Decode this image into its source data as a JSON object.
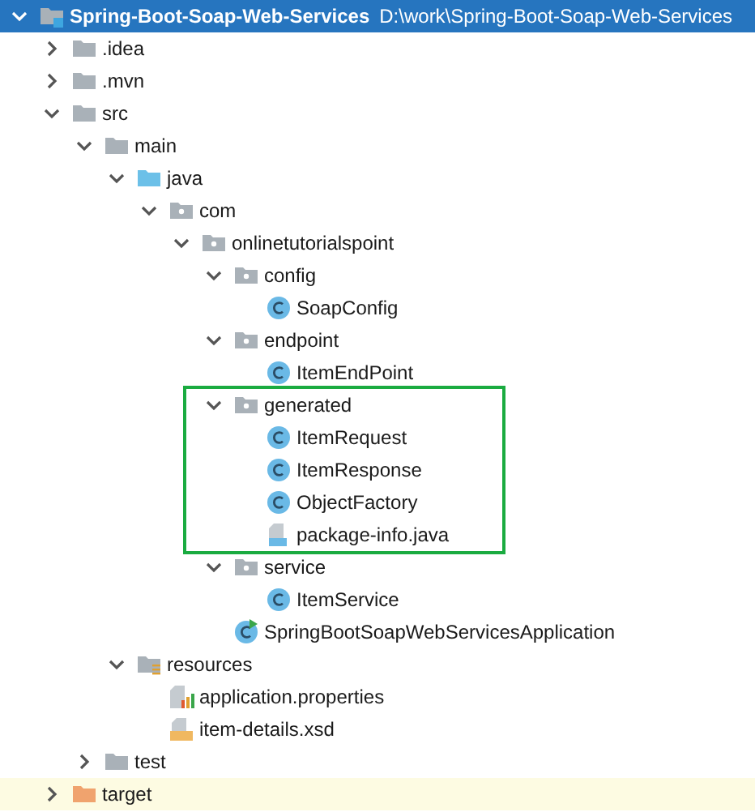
{
  "tree": [
    {
      "kind": "module",
      "name": "Spring-Boot-Soap-Web-Services",
      "path": "D:\\work\\Spring-Boot-Soap-Web-Services",
      "selected": true,
      "expanded": true,
      "children": [
        {
          "kind": "folder",
          "name": ".idea",
          "selected": false,
          "expanded": false
        },
        {
          "kind": "folder",
          "name": ".mvn",
          "selected": false,
          "expanded": false
        },
        {
          "kind": "folder",
          "name": "src",
          "selected": false,
          "expanded": true,
          "children": [
            {
              "kind": "folder",
              "name": "main",
              "selected": false,
              "expanded": true,
              "children": [
                {
                  "kind": "source-folder",
                  "name": "java",
                  "selected": false,
                  "expanded": true,
                  "children": [
                    {
                      "kind": "package",
                      "name": "com",
                      "selected": false,
                      "expanded": true,
                      "children": [
                        {
                          "kind": "package",
                          "name": "onlinetutorialspoint",
                          "selected": false,
                          "expanded": true,
                          "children": [
                            {
                              "kind": "package",
                              "name": "config",
                              "selected": false,
                              "expanded": true,
                              "children": [
                                {
                                  "kind": "class",
                                  "name": "SoapConfig",
                                  "selected": false
                                }
                              ]
                            },
                            {
                              "kind": "package",
                              "name": "endpoint",
                              "selected": false,
                              "expanded": true,
                              "children": [
                                {
                                  "kind": "class",
                                  "name": "ItemEndPoint",
                                  "selected": false
                                }
                              ]
                            },
                            {
                              "kind": "package",
                              "name": "generated",
                              "selected": false,
                              "expanded": true,
                              "highlighted": true,
                              "children": [
                                {
                                  "kind": "class",
                                  "name": "ItemRequest",
                                  "selected": false
                                },
                                {
                                  "kind": "class",
                                  "name": "ItemResponse",
                                  "selected": false
                                },
                                {
                                  "kind": "class",
                                  "name": "ObjectFactory",
                                  "selected": false
                                },
                                {
                                  "kind": "java-file",
                                  "name": "package-info.java",
                                  "selected": false
                                }
                              ]
                            },
                            {
                              "kind": "package",
                              "name": "service",
                              "selected": false,
                              "expanded": true,
                              "children": [
                                {
                                  "kind": "class",
                                  "name": "ItemService",
                                  "selected": false
                                }
                              ]
                            },
                            {
                              "kind": "main-class",
                              "name": "SpringBootSoapWebServicesApplication",
                              "selected": false
                            }
                          ]
                        }
                      ]
                    }
                  ]
                },
                {
                  "kind": "resource-folder",
                  "name": "resources",
                  "selected": false,
                  "expanded": true,
                  "children": [
                    {
                      "kind": "properties",
                      "name": "application.properties",
                      "selected": false
                    },
                    {
                      "kind": "xsd",
                      "name": "item-details.xsd",
                      "selected": false
                    }
                  ]
                }
              ]
            },
            {
              "kind": "folder",
              "name": "test",
              "selected": false,
              "expanded": false
            }
          ]
        },
        {
          "kind": "excluded-folder",
          "name": "target",
          "selected": false,
          "expanded": false
        }
      ]
    }
  ]
}
